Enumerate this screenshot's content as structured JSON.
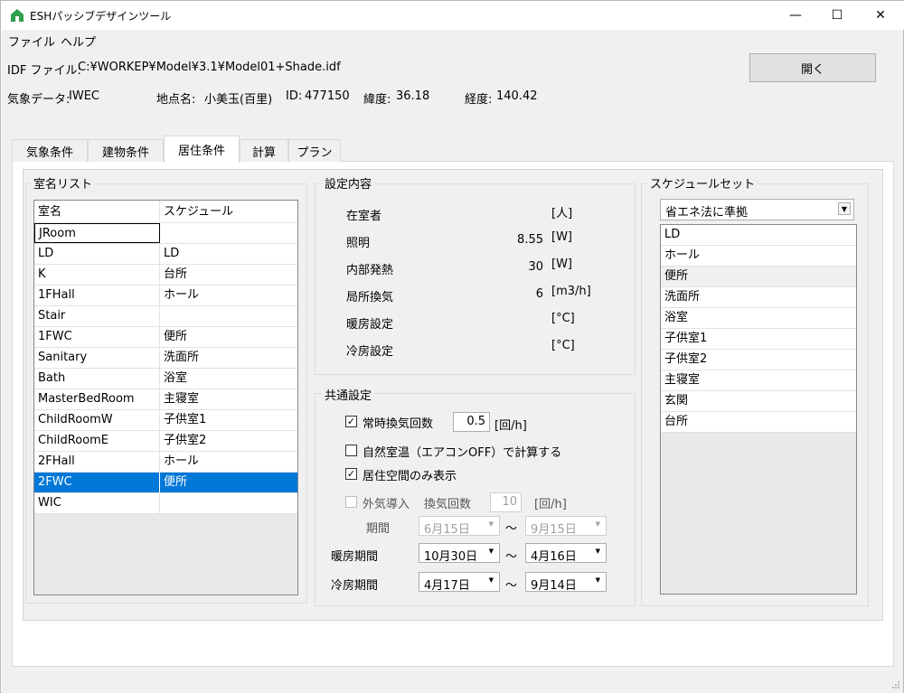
{
  "window": {
    "title": "ESHパッシブデザインツール",
    "min": "—",
    "max": "☐",
    "close": "✕"
  },
  "menu": {
    "file": "ファイル",
    "help": "ヘルプ"
  },
  "header": {
    "idf_label": "IDF ファイル:",
    "idf_path": "C:¥WORKEP¥Model¥3.1¥Model01+Shade.idf",
    "open_button": "開く",
    "weather_label": "気象データ:",
    "weather_value": "IWEC",
    "place_label": "地点名:",
    "place_value": "小美玉(百里)",
    "id_label": "ID:",
    "id_value": "477150",
    "lat_label": "緯度:",
    "lat_value": "36.18",
    "lon_label": "経度:",
    "lon_value": "140.42"
  },
  "tabs": [
    "気象条件",
    "建物条件",
    "居住条件",
    "計算",
    "プラン"
  ],
  "room_list": {
    "title": "室名リスト",
    "col_name": "室名",
    "col_schedule": "スケジュール",
    "rows": [
      {
        "name": "JRoom",
        "schedule": ""
      },
      {
        "name": "LD",
        "schedule": "LD"
      },
      {
        "name": "K",
        "schedule": "台所"
      },
      {
        "name": "1FHall",
        "schedule": "ホール"
      },
      {
        "name": "Stair",
        "schedule": ""
      },
      {
        "name": "1FWC",
        "schedule": "便所"
      },
      {
        "name": "Sanitary",
        "schedule": "洗面所"
      },
      {
        "name": "Bath",
        "schedule": "浴室"
      },
      {
        "name": "MasterBedRoom",
        "schedule": "主寝室"
      },
      {
        "name": "ChildRoomW",
        "schedule": "子供室1"
      },
      {
        "name": "ChildRoomE",
        "schedule": "子供室2"
      },
      {
        "name": "2FHall",
        "schedule": "ホール"
      },
      {
        "name": "2FWC",
        "schedule": "便所"
      },
      {
        "name": "WIC",
        "schedule": ""
      }
    ]
  },
  "settings": {
    "title": "設定内容",
    "rows": [
      {
        "label": "在室者",
        "value": "",
        "unit": "[人]"
      },
      {
        "label": "照明",
        "value": "8.55",
        "unit": "[W]"
      },
      {
        "label": "内部発熱",
        "value": "30",
        "unit": "[W]"
      },
      {
        "label": "局所換気",
        "value": "6",
        "unit": "[m3/h]"
      },
      {
        "label": "暖房設定",
        "value": "",
        "unit": "[°C]"
      },
      {
        "label": "冷房設定",
        "value": "",
        "unit": "[°C]"
      }
    ]
  },
  "common": {
    "title": "共通設定",
    "vent_label": "常時換気回数",
    "vent_value": "0.5",
    "vent_unit": "[回/h]",
    "natural_label": "自然室温（エアコンOFF）で計算する",
    "living_only_label": "居住空間のみ表示",
    "outdoor_label": "外気導入",
    "outdoor_rate_label": "換気回数",
    "outdoor_rate_value": "10",
    "outdoor_rate_unit": "[回/h]",
    "period_label": "期間",
    "period_from": "6月15日",
    "period_to": "9月15日",
    "heat_label": "暖房期間",
    "heat_from": "10月30日",
    "heat_to": "4月16日",
    "cool_label": "冷房期間",
    "cool_from": "4月17日",
    "cool_to": "9月14日",
    "tilde": "～",
    "check_mark": "✓"
  },
  "schedule_set": {
    "title": "スケジュールセット",
    "selected": "省エネ法に準拠",
    "items": [
      "LD",
      "ホール",
      "便所",
      "洗面所",
      "浴室",
      "子供室1",
      "子供室2",
      "主寝室",
      "玄関",
      "台所"
    ]
  }
}
